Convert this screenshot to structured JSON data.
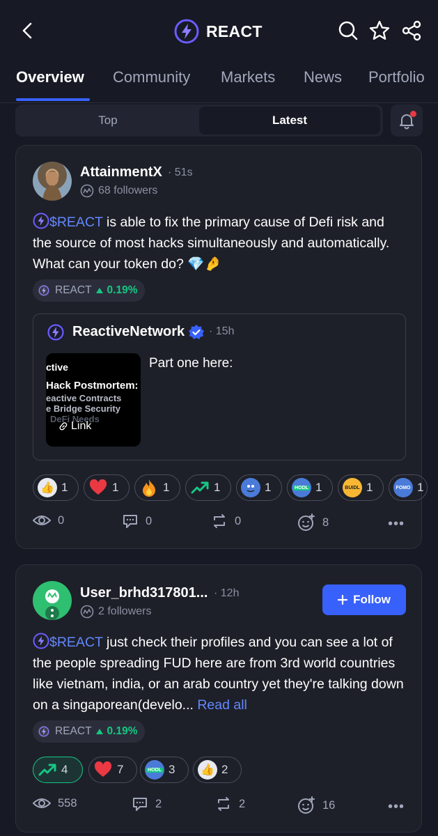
{
  "header": {
    "title": "REACT"
  },
  "tabs": [
    {
      "label": "Overview"
    },
    {
      "label": "Community"
    },
    {
      "label": "Markets"
    },
    {
      "label": "News"
    },
    {
      "label": "Portfolio"
    }
  ],
  "feed_toggle": {
    "top": "Top",
    "latest": "Latest"
  },
  "posts": [
    {
      "username": "AttainmentX",
      "time": "· 51s",
      "followers": "68 followers",
      "cashtag": "$REACT",
      "text": " is able to fix the primary cause of Defi risk and the source of most hacks simultaneously and automatically. What can your token do? 💎🤌",
      "coin": {
        "symbol": "REACT",
        "change": "0.19%"
      },
      "quote": {
        "username": "ReactiveNetwork",
        "time": "· 15h",
        "text": "Part one here:",
        "thumb_lines": [
          "ctive",
          "Hack Postmortem:",
          "eactive Contracts",
          "e Bridge Security",
          "DeFi Needs"
        ],
        "link_label": "Link"
      },
      "reactions": [
        {
          "name": "thumbs-up",
          "count": "1"
        },
        {
          "name": "heart",
          "count": "1"
        },
        {
          "name": "fire",
          "count": "1"
        },
        {
          "name": "trending-up",
          "count": "1"
        },
        {
          "name": "rocket-mascot",
          "count": "1"
        },
        {
          "name": "hodl",
          "count": "1",
          "label": "HODL"
        },
        {
          "name": "buidl",
          "count": "1",
          "label": "BUIDL"
        },
        {
          "name": "fomo",
          "count": "1",
          "label": "FOMO"
        }
      ],
      "stats": {
        "views": "0",
        "comments": "0",
        "reposts": "0",
        "reactions": "8"
      }
    },
    {
      "username": "User_brhd317801...",
      "time": "· 12h",
      "followers": "2 followers",
      "follow_label": "Follow",
      "cashtag": "$REACT",
      "text": " just check their profiles and you can see a lot of the people spreading FUD here are from 3rd world countries like vietnam, india, or an arab country yet they're talking down on a singaporean(develo... ",
      "read_all": "Read all",
      "coin": {
        "symbol": "REACT",
        "change": "0.19%"
      },
      "reactions": [
        {
          "name": "trending-up",
          "count": "4"
        },
        {
          "name": "heart",
          "count": "7"
        },
        {
          "name": "hodl",
          "count": "3",
          "label": "HODL"
        },
        {
          "name": "thumbs-up",
          "count": "2"
        }
      ],
      "stats": {
        "views": "558",
        "comments": "2",
        "reposts": "2",
        "reactions": "16"
      }
    }
  ],
  "colors": {
    "accent": "#3861fb",
    "positive": "#16c784",
    "background": "#171924",
    "card": "#1e2029"
  }
}
